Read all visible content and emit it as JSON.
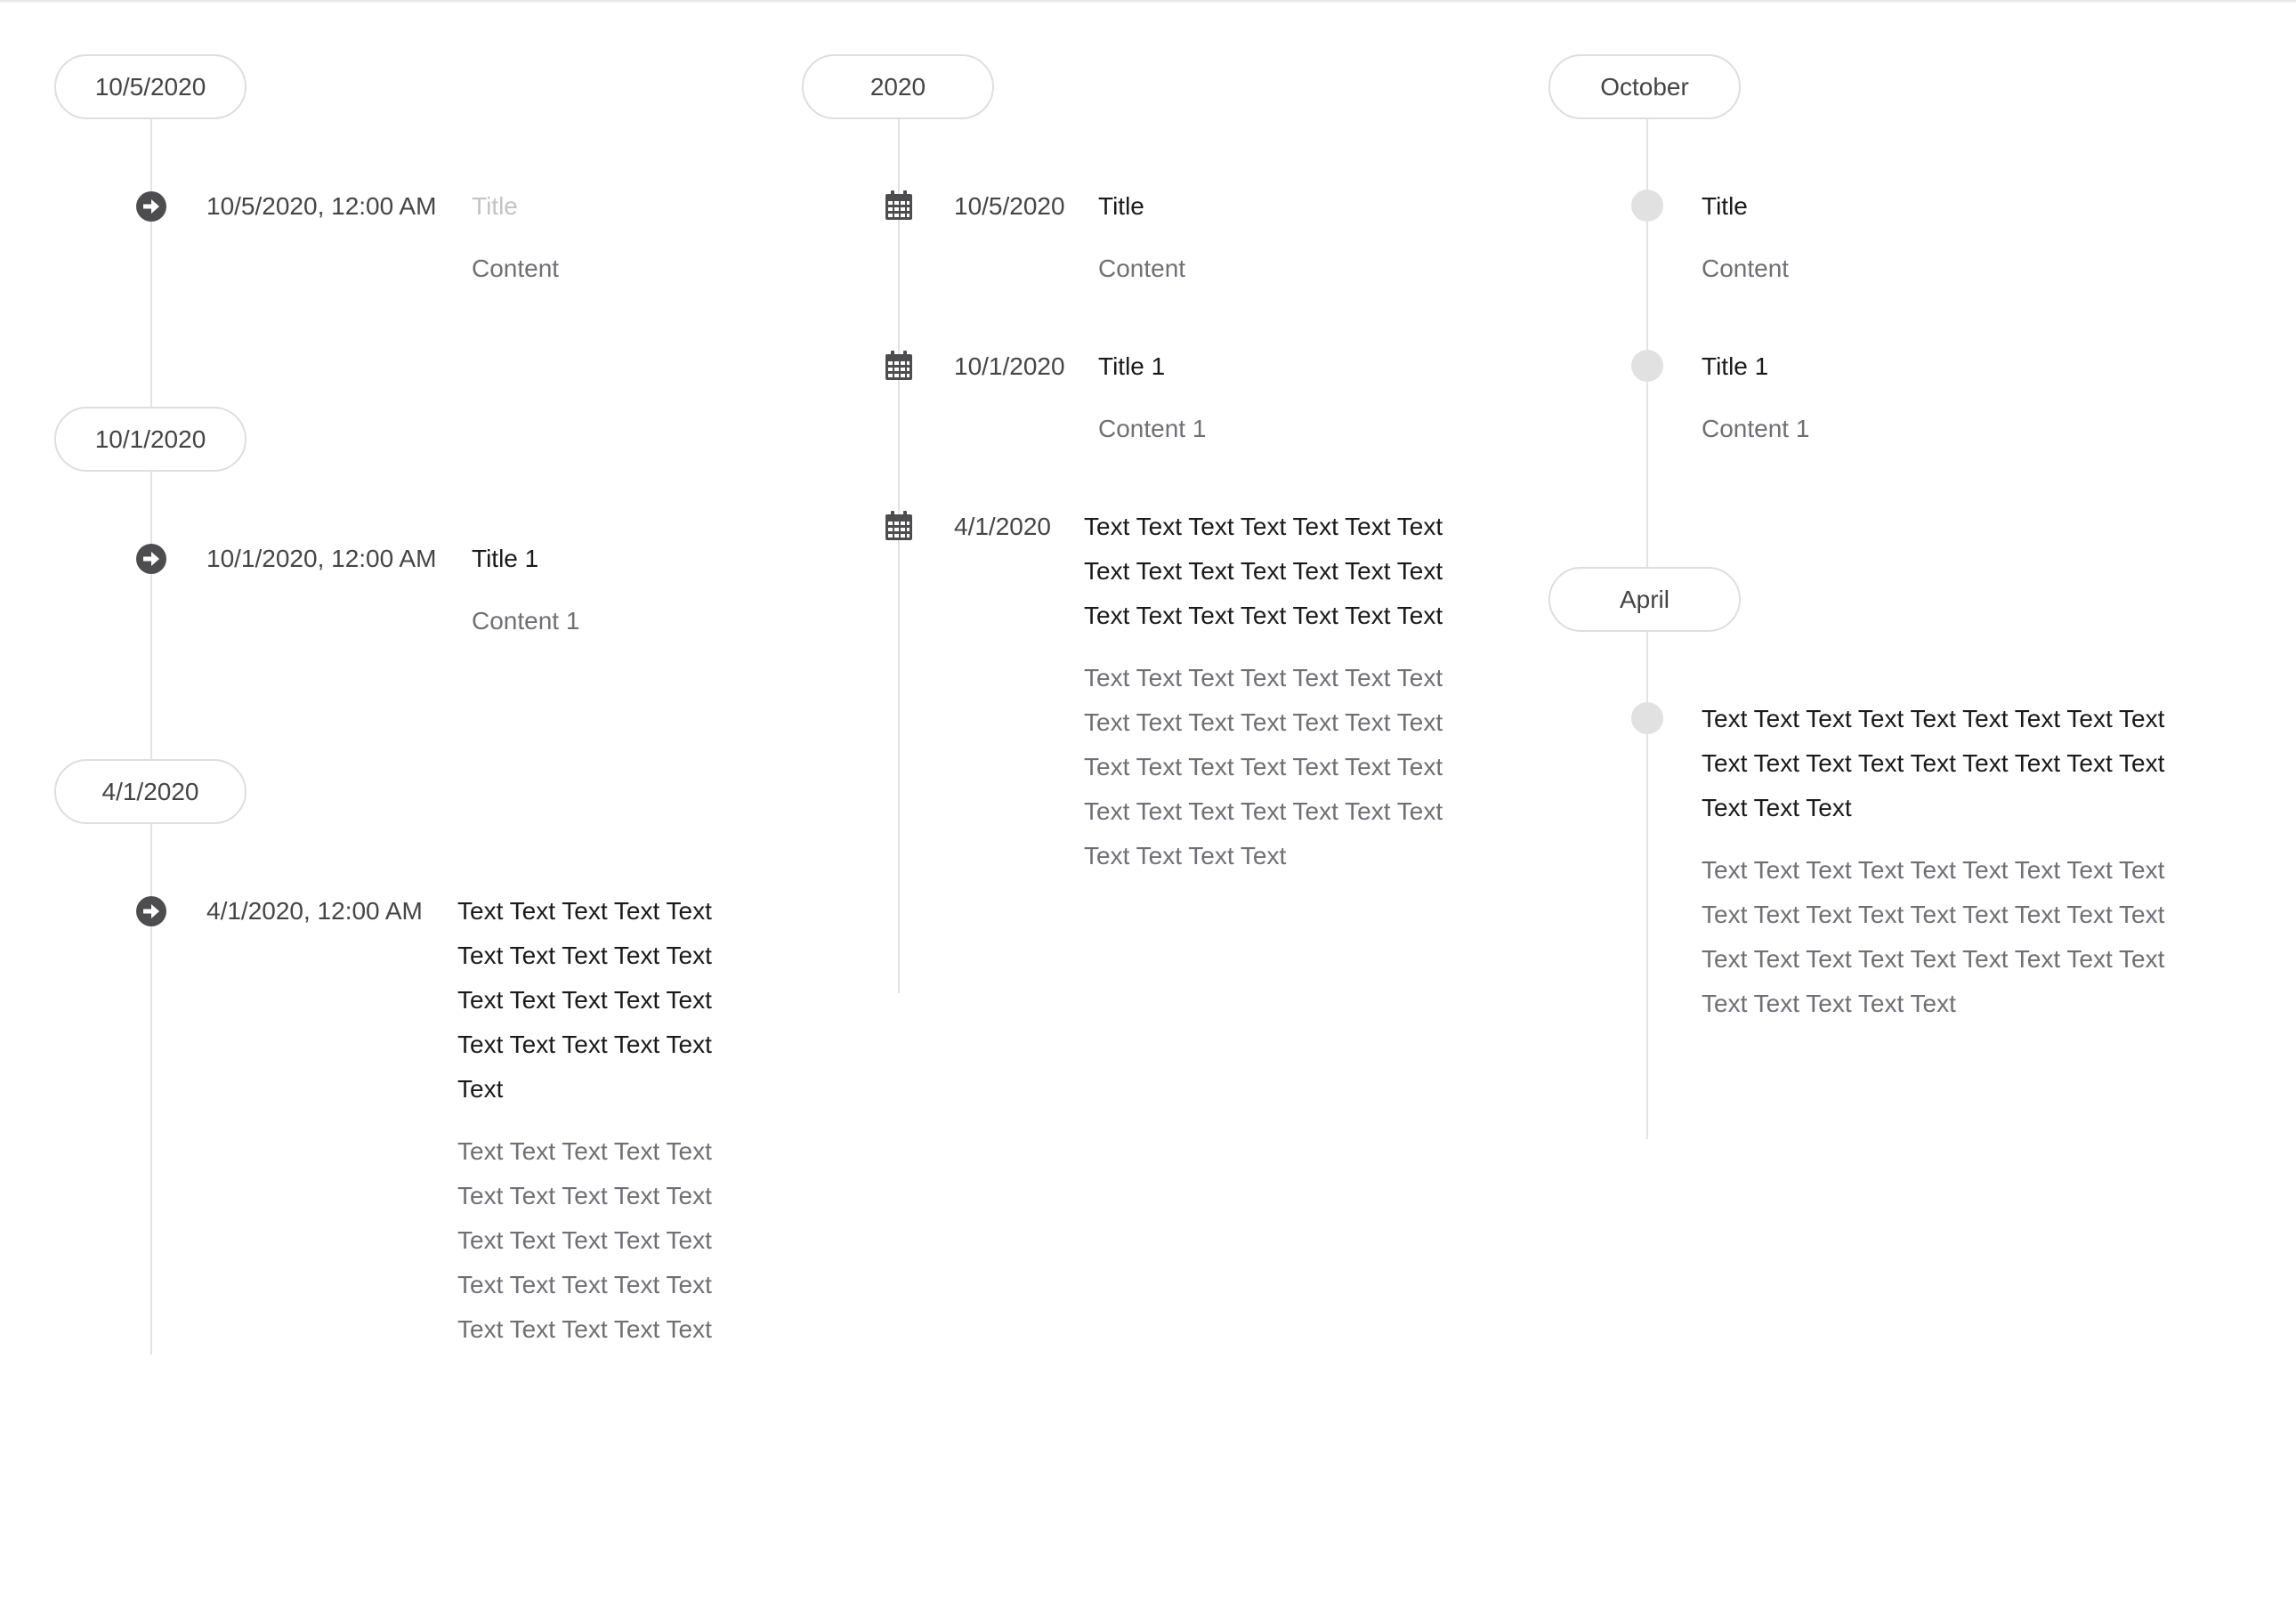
{
  "timelines": [
    {
      "marker_style": "arrow",
      "groups": [
        {
          "label": "10/5/2020",
          "items": [
            {
              "stamp": "10/5/2020, 12:00 AM",
              "title": "Title",
              "title_is_placeholder": true,
              "content": "Content"
            }
          ]
        },
        {
          "label": "10/1/2020",
          "items": [
            {
              "stamp": "10/1/2020, 12:00 AM",
              "title": "Title 1",
              "content": "Content 1"
            }
          ]
        },
        {
          "label": "4/1/2020",
          "items": [
            {
              "stamp": "4/1/2020, 12:00 AM",
              "title": "Text Text Text Text Text Text Text Text Text Text Text Text Text Text Text Text Text Text Text Text Text",
              "content": "Text Text Text Text Text Text Text Text Text Text Text Text Text Text Text Text Text Text Text Text Text Text Text Text Text"
            }
          ]
        }
      ]
    },
    {
      "marker_style": "calendar",
      "groups": [
        {
          "label": "2020",
          "items": [
            {
              "stamp": "10/5/2020",
              "title": "Title",
              "content": "Content"
            },
            {
              "stamp": "10/1/2020",
              "title": "Title 1",
              "content": "Content 1"
            },
            {
              "stamp": "4/1/2020",
              "title": "Text Text Text Text Text Text Text Text Text Text Text Text Text Text Text Text Text Text Text Text Text",
              "content": "Text Text Text Text Text Text Text Text Text Text Text Text Text Text Text Text Text Text Text Text Text Text Text Text Text Text Text Text Text Text Text Text"
            }
          ]
        }
      ]
    },
    {
      "marker_style": "dot",
      "groups": [
        {
          "label": "October",
          "items": [
            {
              "stamp": "",
              "title": "Title",
              "content": "Content"
            },
            {
              "stamp": "",
              "title": "Title 1",
              "content": "Content 1"
            }
          ]
        },
        {
          "label": "April",
          "items": [
            {
              "stamp": "",
              "title": "Text Text Text Text Text Text Text Text Text Text Text Text Text Text Text Text Text Text Text Text Text",
              "content": "Text Text Text Text Text Text Text Text Text Text Text Text Text Text Text Text Text Text Text Text Text Text Text Text Text Text Text Text Text Text Text Text"
            }
          ]
        }
      ]
    }
  ],
  "colors": {
    "rail": "#e3e3e3",
    "pill_border": "#dedede",
    "marker_dark": "#4d4d4f",
    "marker_dot": "#e1e1e2",
    "title": "#1a1a1a",
    "title_placeholder": "#c3c3c3",
    "content": "#6f6f76",
    "stamp": "#454545"
  },
  "icons": {
    "arrow": "arrow-circle-right-icon",
    "calendar": "calendar-icon",
    "dot": "dot-icon"
  }
}
